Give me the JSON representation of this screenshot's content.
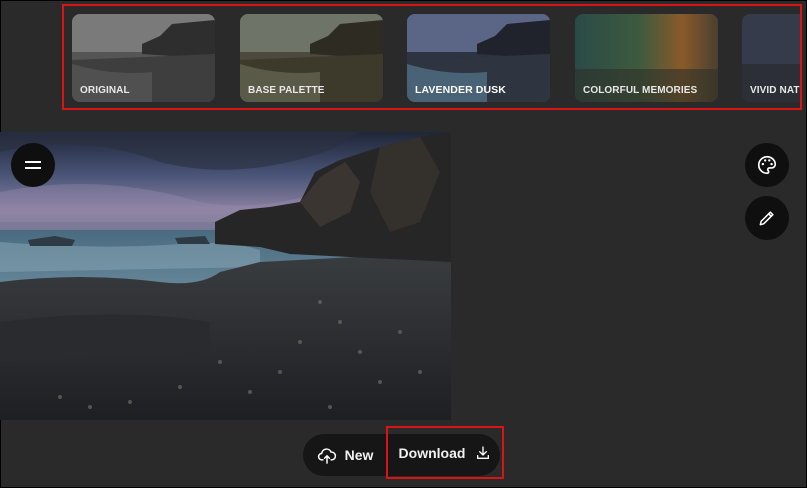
{
  "filters": [
    {
      "label": "ORIGINAL",
      "selected": false,
      "tint": "#6e6e6e"
    },
    {
      "label": "BASE PALETTE",
      "selected": false,
      "tint": "#6a7262"
    },
    {
      "label": "LAVENDER DUSK",
      "selected": true,
      "tint": "#4b5a73"
    },
    {
      "label": "COLORFUL MEMORIES",
      "selected": false,
      "tint": "#3c5a4a"
    },
    {
      "label": "VIVID NATURE",
      "selected": false,
      "tint": "#3b4556"
    }
  ],
  "toolbar": {
    "new_label": "New",
    "download_label": "Download"
  },
  "colors": {
    "highlight": "#d81414",
    "background": "#2a2a2a",
    "button_bg": "#0f0f0f"
  }
}
